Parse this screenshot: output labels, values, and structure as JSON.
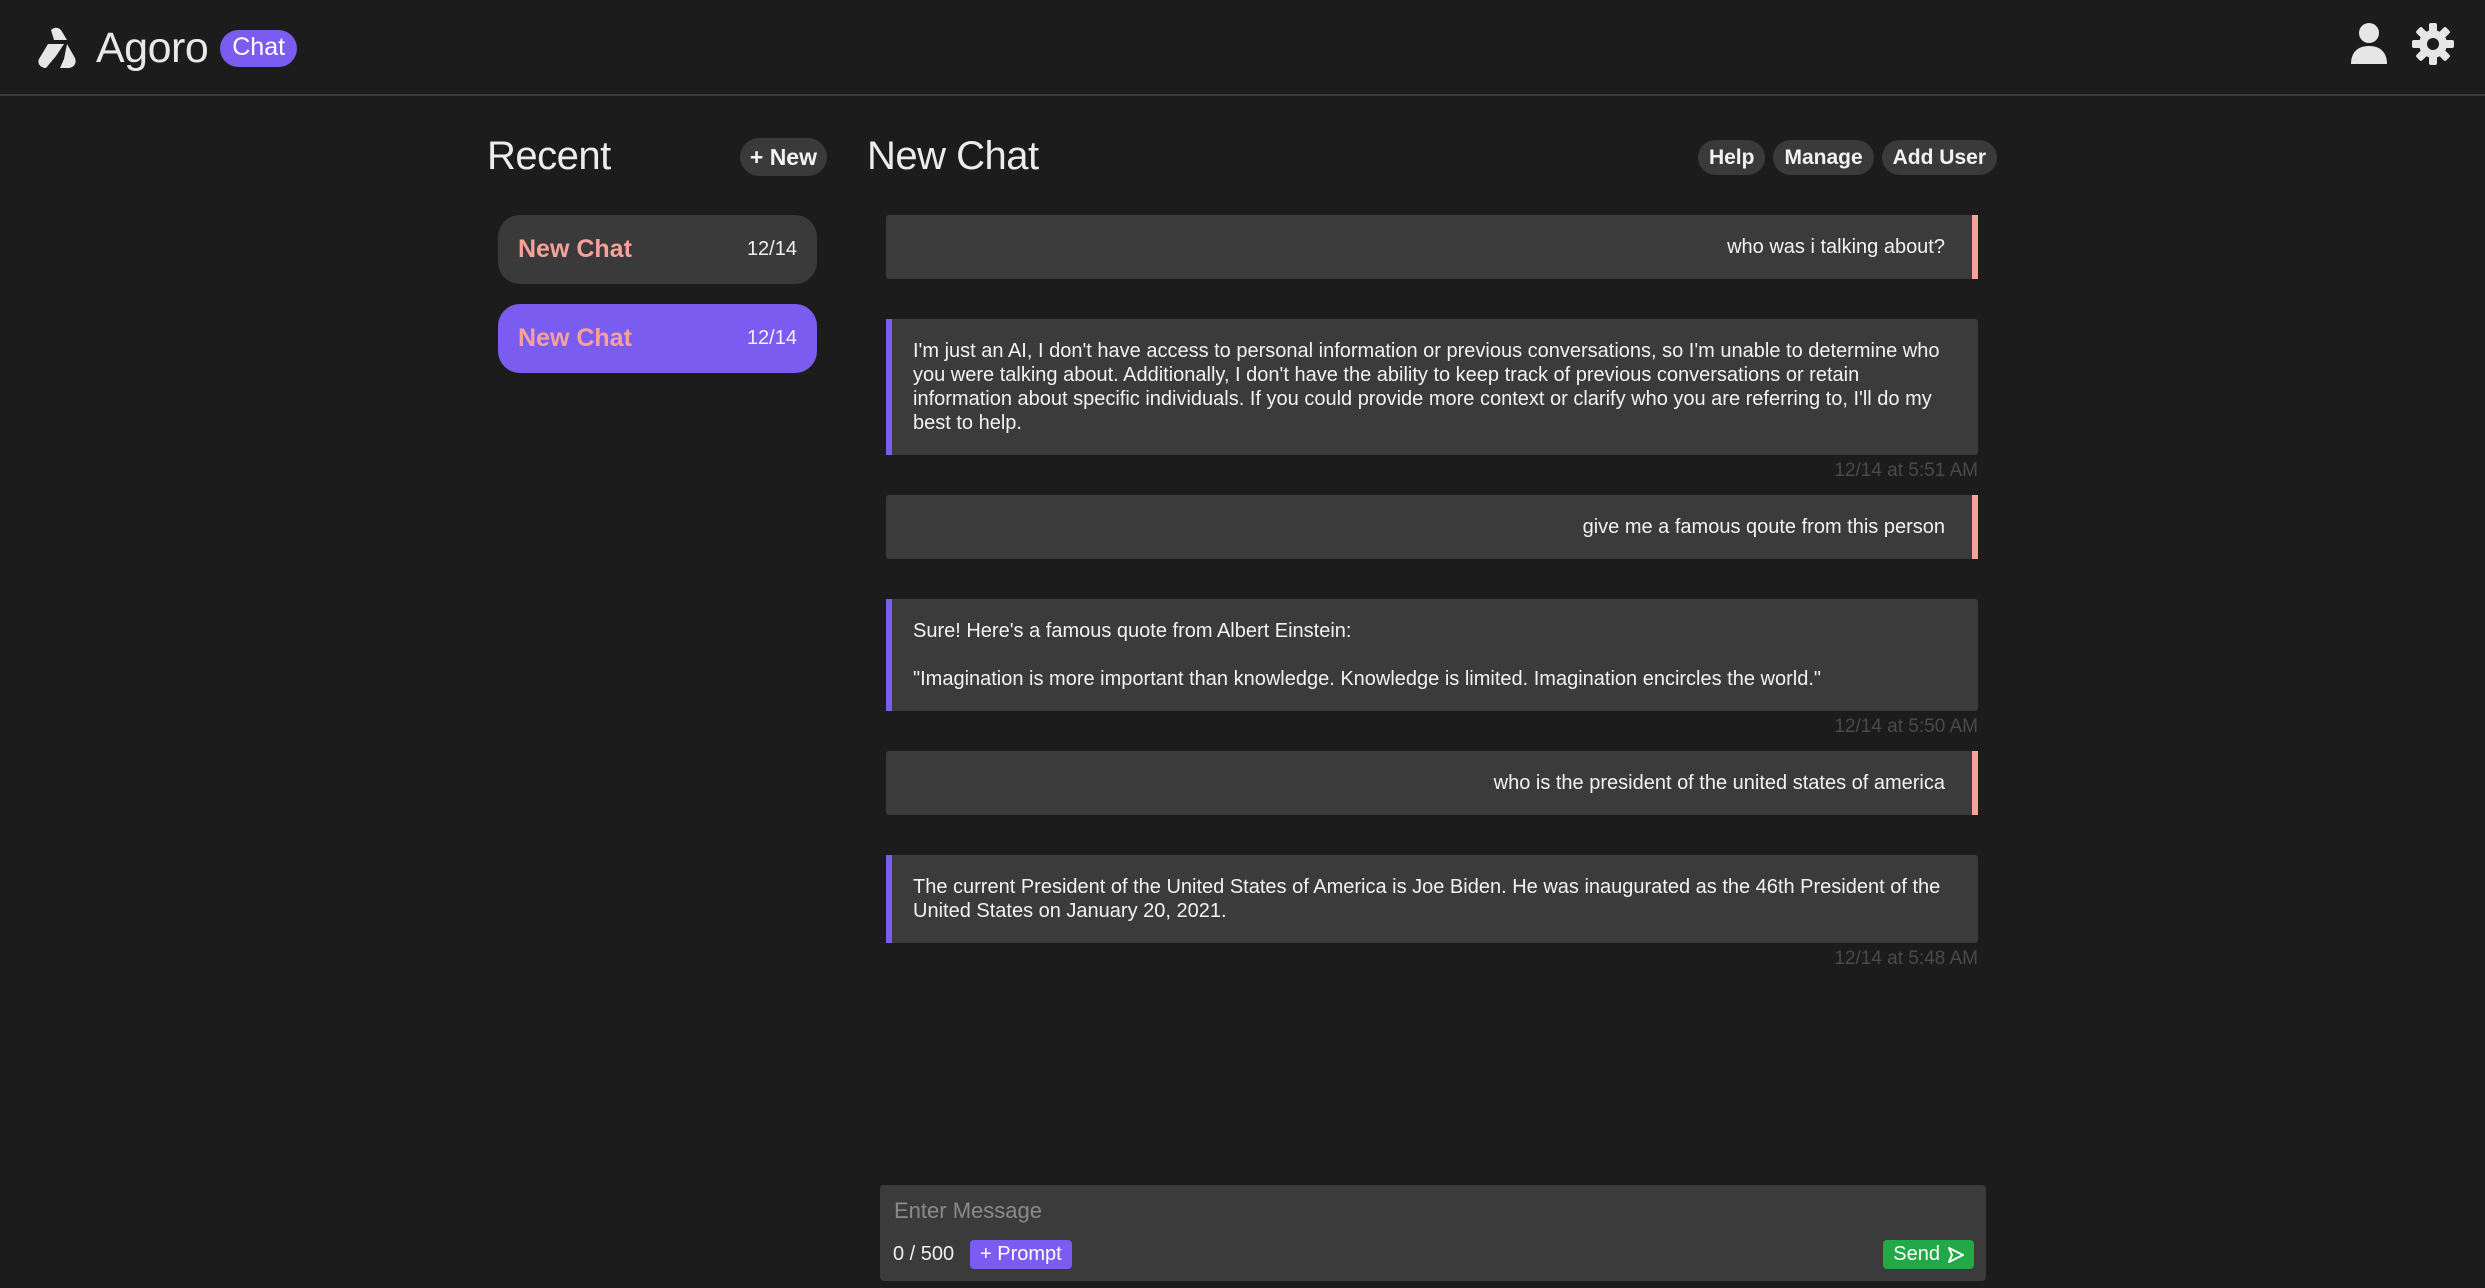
{
  "app": {
    "name": "Agoro",
    "badge": "Chat",
    "icons": {
      "logo": "agoro-logo-icon",
      "user": "user-icon",
      "settings": "gear-icon"
    }
  },
  "sidebar": {
    "title": "Recent",
    "new_label": "+ New",
    "chats": [
      {
        "title": "New Chat",
        "date": "12/14",
        "active": false
      },
      {
        "title": "New Chat",
        "date": "12/14",
        "active": true
      }
    ]
  },
  "main": {
    "title": "New Chat",
    "actions": {
      "help": "Help",
      "manage": "Manage",
      "add_user": "Add User"
    }
  },
  "messages": [
    {
      "role": "user",
      "text": "who was i talking about?"
    },
    {
      "role": "bot",
      "text": "I'm just an AI, I don't have access to personal information or previous conversations, so I'm unable to determine who you were talking about. Additionally, I don't have the ability to keep track of previous conversations or retain information about specific individuals. If you could provide more context or clarify who you are referring to, I'll do my best to help.",
      "time": "12/14 at 5:51 AM"
    },
    {
      "role": "user",
      "text": "give me a famous qoute from this person"
    },
    {
      "role": "bot",
      "text": "Sure! Here's a famous quote from Albert Einstein:\n\n\"Imagination is more important than knowledge. Knowledge is limited. Imagination encircles the world.\"",
      "time": "12/14 at 5:50 AM"
    },
    {
      "role": "user",
      "text": "who is the president of the united states of america"
    },
    {
      "role": "bot",
      "text": "The current President of the United States of America is Joe Biden. He was inaugurated as the 46th President of the United States on January 20, 2021.",
      "time": "12/14 at 5:48 AM"
    }
  ],
  "composer": {
    "placeholder": "Enter Message",
    "value": "",
    "counter": "0 / 500",
    "prompt_label": "+ Prompt",
    "send_label": "Send"
  },
  "colors": {
    "accent": "#7b5cf0",
    "user_bar": "#f5a39a",
    "send": "#22a847",
    "background": "#1c1c1c",
    "bubble": "#3b3b3b"
  }
}
